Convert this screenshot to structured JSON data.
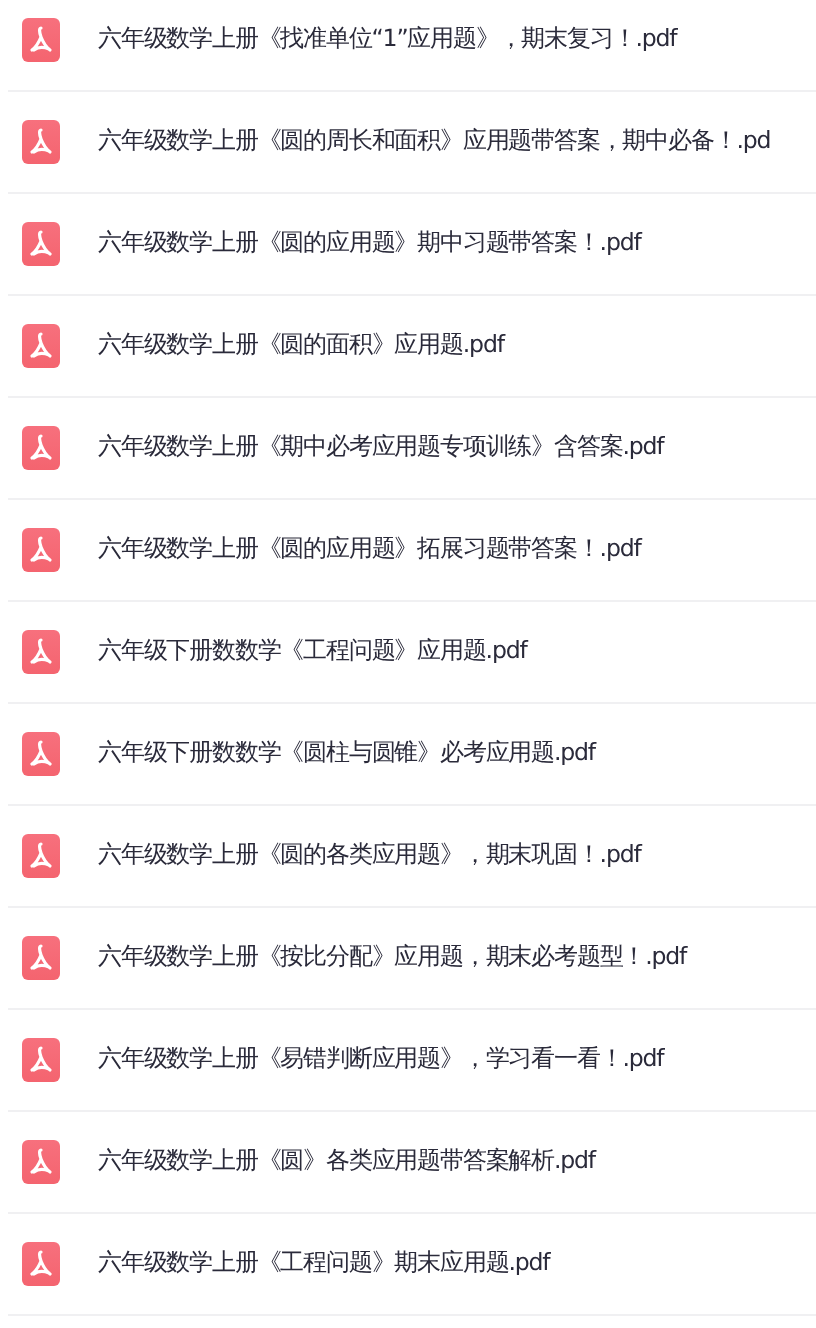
{
  "files": [
    {
      "name": "六年级数学上册《找准单位“1”应用题》，期末复习！.pdf"
    },
    {
      "name": "六年级数学上册《圆的周长和面积》应用题带答案，期中必备！.pd"
    },
    {
      "name": "六年级数学上册《圆的应用题》期中习题带答案！.pdf"
    },
    {
      "name": "六年级数学上册《圆的面积》应用题.pdf"
    },
    {
      "name": "六年级数学上册《期中必考应用题专项训练》含答案.pdf"
    },
    {
      "name": "六年级数学上册《圆的应用题》拓展习题带答案！.pdf"
    },
    {
      "name": "六年级下册数数学《工程问题》应用题.pdf"
    },
    {
      "name": "六年级下册数数学《圆柱与圆锥》必考应用题.pdf"
    },
    {
      "name": "六年级数学上册《圆的各类应用题》，期末巩固！.pdf"
    },
    {
      "name": "六年级数学上册《按比分配》应用题，期末必考题型！.pdf"
    },
    {
      "name": "六年级数学上册《易错判断应用题》，学习看一看！.pdf"
    },
    {
      "name": "六年级数学上册《圆》各类应用题带答案解析.pdf"
    },
    {
      "name": "六年级数学上册《工程问题》期末应用题.pdf"
    }
  ]
}
